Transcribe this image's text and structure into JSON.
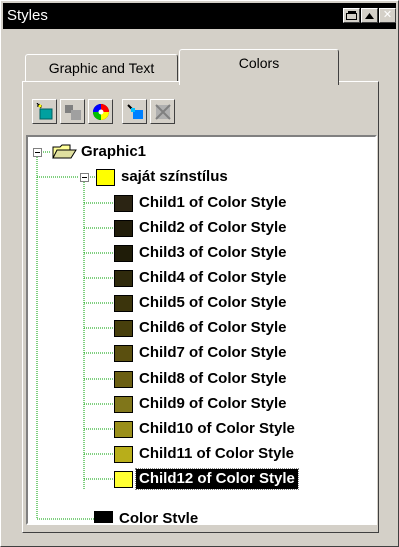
{
  "window": {
    "title": "Styles",
    "controls": [
      {
        "name": "restore-icon"
      },
      {
        "name": "maximize-icon"
      },
      {
        "name": "close-icon",
        "glyph": "✕"
      }
    ]
  },
  "tabs": [
    {
      "label": "Graphic and Text",
      "active": false
    },
    {
      "label": "Colors",
      "active": true
    }
  ],
  "toolbar": [
    {
      "icon": "new-style-icon"
    },
    {
      "icon": "new-child-style-icon"
    },
    {
      "icon": "color-wheel-icon"
    },
    {
      "icon": "apply-style-icon"
    },
    {
      "icon": "delete-style-icon"
    }
  ],
  "tree": {
    "root": {
      "label": "Graphic1",
      "icon": "folder-open-icon",
      "expanded": true
    },
    "group": {
      "label": "saját színstílus",
      "swatch": "#ffff00",
      "expanded": true
    },
    "children": [
      {
        "label": "Child1 of Color Style",
        "swatch": "#2b2413"
      },
      {
        "label": "Child2 of Color Style",
        "swatch": "#211d0a"
      },
      {
        "label": "Child3 of Color Style",
        "swatch": "#1f1c08"
      },
      {
        "label": "Child4 of Color Style",
        "swatch": "#2f2a0c"
      },
      {
        "label": "Child5 of Color Style",
        "swatch": "#3b340c"
      },
      {
        "label": "Child6 of Color Style",
        "swatch": "#473f0c"
      },
      {
        "label": "Child7 of Color Style",
        "swatch": "#5a4f0f"
      },
      {
        "label": "Child8 of Color Style",
        "swatch": "#6b5f12"
      },
      {
        "label": "Child9 of Color Style",
        "swatch": "#80761a"
      },
      {
        "label": "Child10 of Color Style",
        "swatch": "#9a8f1a"
      },
      {
        "label": "Child11 of Color Style",
        "swatch": "#b8ae1a"
      },
      {
        "label": "Child12 of Color Style",
        "swatch": "#ffff33",
        "selected": true
      }
    ],
    "other": {
      "label": "Color Style",
      "swatch": "#000000"
    }
  },
  "colors": {
    "selection": "#000000",
    "tree_lines": "#00a000",
    "window": "#d4d0c8"
  }
}
